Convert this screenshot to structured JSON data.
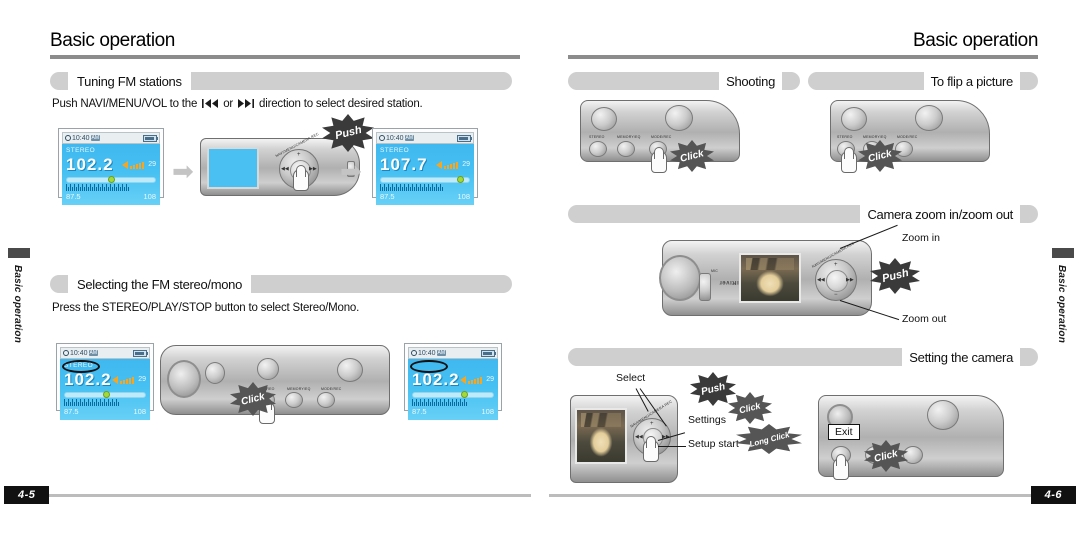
{
  "left_page": {
    "title": "Basic operation",
    "spine_label": "Basic operation",
    "page_number": "4-5",
    "sections": [
      {
        "id": "tuning",
        "heading": "Tuning FM stations",
        "body_prefix": "Push NAVI/MENU/VOL to the",
        "body_mid": "or",
        "body_suffix": "direction to select desired station.",
        "icon_prev": "rewind-icon",
        "icon_next": "fast-forward-icon"
      },
      {
        "id": "stereo-mono",
        "heading": "Selecting the FM stereo/mono",
        "body": "Press the STEREO/PLAY/STOP button to select Stereo/Mono."
      }
    ],
    "lcd_before": {
      "time": "10:40",
      "ampm": "AM",
      "stereo_label": "STEREO",
      "frequency": "102.2",
      "volume": "29",
      "range_min": "87.5",
      "range_max": "108",
      "knob_position_pct": 47
    },
    "lcd_after": {
      "time": "10:40",
      "ampm": "AM",
      "stereo_label": "STEREO",
      "frequency": "107.7",
      "volume": "29",
      "range_min": "87.5",
      "range_max": "108",
      "knob_position_pct": 86
    },
    "lcd_stereo_on": {
      "time": "10:40",
      "ampm": "AM",
      "stereo_label": "STEREO",
      "frequency": "102.2",
      "volume": "29",
      "range_min": "87.5",
      "range_max": "108",
      "knob_position_pct": 47
    },
    "lcd_stereo_off": {
      "time": "10:40",
      "ampm": "AM",
      "stereo_label": "",
      "frequency": "102.2",
      "volume": "29",
      "range_min": "87.5",
      "range_max": "108",
      "knob_position_pct": 60
    },
    "device_tuning": {
      "jog_ring_text": "NAVI/MENU/CAMERA REC",
      "burst": "Push"
    },
    "device_stereo": {
      "burst": "Click",
      "button_labels": [
        "STEREO",
        "MEMORY/EQ",
        "MODE/REC"
      ]
    }
  },
  "right_page": {
    "title": "Basic operation",
    "spine_label": "Basic operation",
    "page_number": "4-6",
    "sections": [
      {
        "id": "shooting",
        "heading": "Shooting",
        "burst": "Click"
      },
      {
        "id": "flip",
        "heading": "To flip a picture",
        "burst": "Click"
      },
      {
        "id": "zoom",
        "heading": "Camera zoom in/zoom out",
        "callouts": [
          "Zoom in",
          "Zoom out"
        ],
        "burst": "Push",
        "jog_ring_text": "NAVI/MENU/CAMERA REC",
        "mic_label": "MIC",
        "brand": "iRiver"
      },
      {
        "id": "setting",
        "heading": "Setting the camera",
        "callouts": [
          "Select",
          "Settings",
          "Setup start",
          "Exit"
        ],
        "bursts": [
          "Push",
          "Click",
          "Long Click",
          "Click"
        ],
        "jog_ring_text": "NAVI/MENU/CAMERA REC"
      }
    ],
    "shooting_button_labels": [
      "STEREO",
      "MEMORY/EQ",
      "MODE/REC"
    ],
    "flip_button_labels": [
      "STEREO",
      "MEMORY/EQ",
      "MODE/REC"
    ]
  }
}
